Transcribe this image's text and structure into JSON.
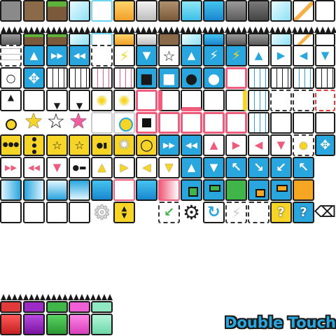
{
  "tileset": {
    "watermark": "Double Touch",
    "colors": {
      "grass": "#5fb33b",
      "dirt": "#8a6a48",
      "metal": "#d9d9d9",
      "stone": "#6f6f6f",
      "ice": "#8fe1f5",
      "gold": "#f0a02a",
      "blue": "#2aa6df",
      "yellow": "#f6d528",
      "pink": "#ef5b7a",
      "green": "#3fb54a",
      "orange": "#f5a623",
      "red": "#e23a3a",
      "purple": "#9b2bc4",
      "magenta": "#f05fd6",
      "mint": "#8fe8c0"
    },
    "question_glyph": "?",
    "glyphs": {
      "up": "▲",
      "down": "▼",
      "left": "◀",
      "right": "▶",
      "ff": "▶▶",
      "rw": "◀◀",
      "bolt": "⚡",
      "star": "★",
      "star_outline": "☆",
      "gear": "⚙",
      "eraser": "⌫",
      "refresh": "↻",
      "sun": "✺",
      "circle": "●",
      "ring": "○",
      "square": "■",
      "arrow_ul": "↖",
      "arrow_ur": "↗",
      "arrow_dl": "↙",
      "arrow_dr": "↘",
      "plus4": "✥"
    },
    "bottom_blocks": [
      "red",
      "purple",
      "green",
      "magenta",
      "mint"
    ]
  }
}
